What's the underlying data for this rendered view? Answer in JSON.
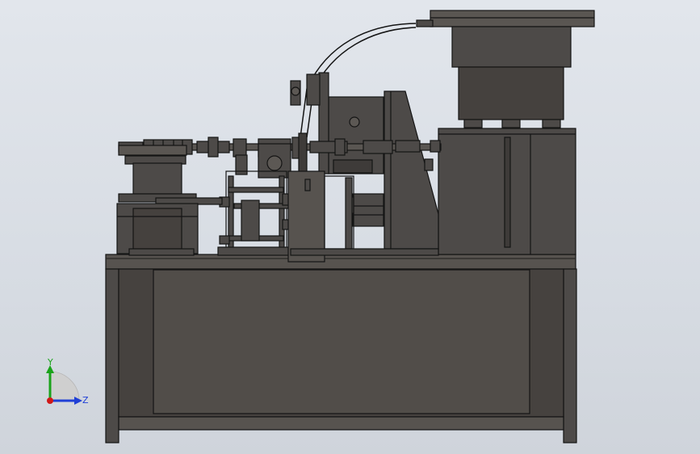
{
  "scene": {
    "background_top": "#e2e6ec",
    "background_bottom": "#cfd4db",
    "part_color": "#4d4a48",
    "part_edge": "#141414",
    "part_highlight": "#6a6764"
  },
  "triad": {
    "y_label": "Y",
    "z_label": "Z",
    "y_color": "#1aa31a",
    "z_color": "#1f3fd6",
    "x_color": "#d01818"
  }
}
